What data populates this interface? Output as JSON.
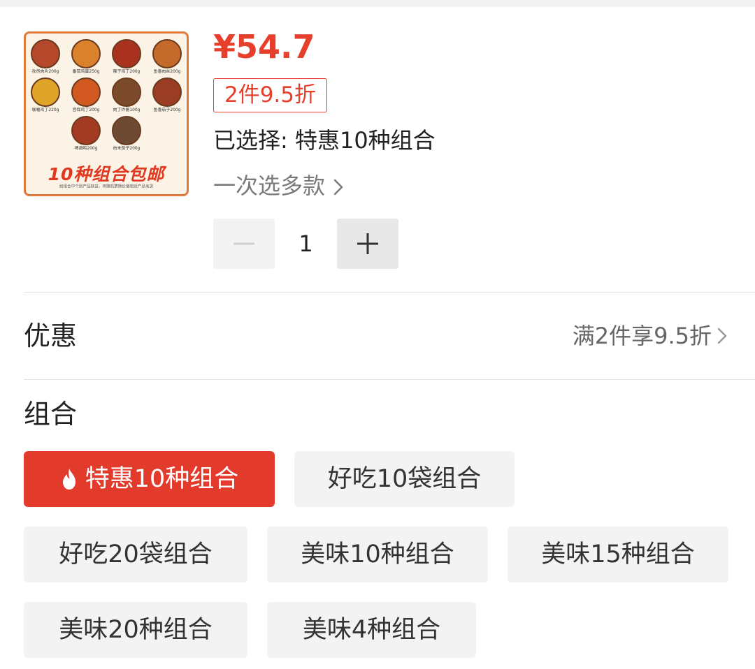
{
  "product": {
    "thumbnail": {
      "items": [
        {
          "label": "孜然肉片200g",
          "color": "#b5472a"
        },
        {
          "label": "番茄鸡蛋250g",
          "color": "#d9822b"
        },
        {
          "label": "辣子鸡丁200g",
          "color": "#a8321e"
        },
        {
          "label": "鱼香肉丝200g",
          "color": "#c46a2a"
        },
        {
          "label": "咖喱鸡丁220g",
          "color": "#e0a528"
        },
        {
          "label": "宫保鸡丁200g",
          "color": "#d25a22"
        },
        {
          "label": "肉丁炸酱100g",
          "color": "#7a4a2a"
        },
        {
          "label": "鱼香茄子200g",
          "color": "#9a3d24"
        },
        {
          "label": "啤酒鸭200g",
          "color": "#a33b22"
        },
        {
          "label": "肉末茄子200g",
          "color": "#6e4a32"
        }
      ],
      "banner": "10种组合包邮",
      "fine_print": "如组合中个别产品缺货，将随机更换价值相近产品发货"
    },
    "price": "¥54.7",
    "discount_tag": "2件9.5折",
    "selected_text": "已选择: 特惠10种组合",
    "multi_select_text": "一次选多款",
    "quantity": "1"
  },
  "promotion": {
    "label": "优惠",
    "detail": "满2件享9.5折"
  },
  "combos": {
    "label": "组合",
    "options": [
      {
        "label": "特惠10种组合",
        "selected": true
      },
      {
        "label": "好吃10袋组合",
        "selected": false
      },
      {
        "label": "好吃20袋组合",
        "selected": false
      },
      {
        "label": "美味10种组合",
        "selected": false
      },
      {
        "label": "美味15种组合",
        "selected": false
      },
      {
        "label": "美味20种组合",
        "selected": false
      },
      {
        "label": "美味4种组合",
        "selected": false
      }
    ]
  },
  "colors": {
    "accent": "#e6402c",
    "selected_chip": "#e33b2b",
    "chip_bg": "#f3f3f3"
  },
  "icons": {
    "minus": "minus-icon",
    "plus": "plus-icon",
    "chevron": "chevron-right-icon",
    "fire": "fire-icon"
  }
}
